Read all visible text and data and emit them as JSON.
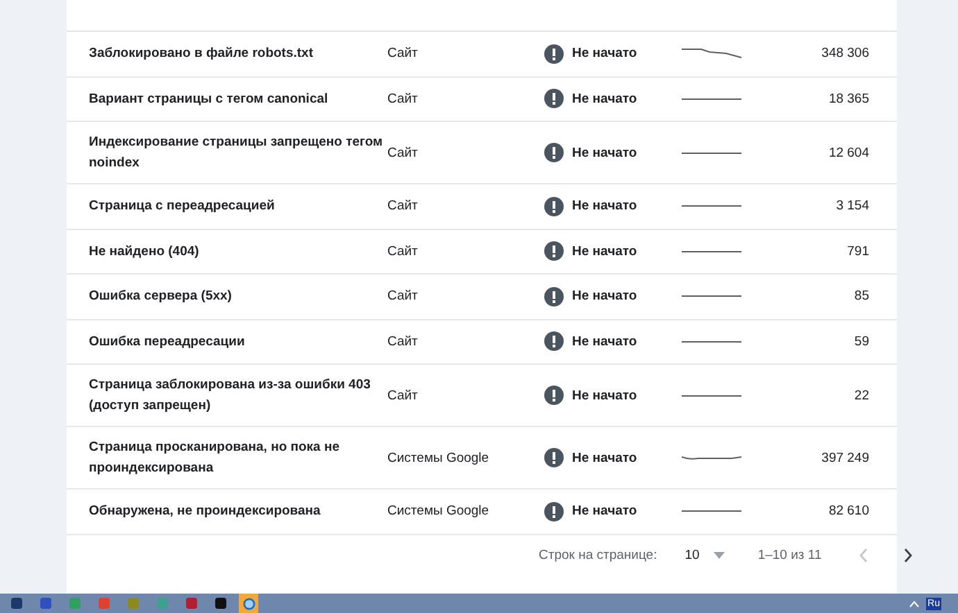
{
  "table": {
    "rows": [
      {
        "reason": "Заблокировано в файле robots.txt",
        "source": "Сайт",
        "status": "Не начато",
        "kind": "falling",
        "pages": "348 306"
      },
      {
        "reason": "Вариант страницы с тегом canonical",
        "source": "Сайт",
        "status": "Не начато",
        "kind": "flat",
        "pages": "18 365"
      },
      {
        "reason": "Индексирование страницы запрещено тегом noindex",
        "source": "Сайт",
        "status": "Не начато",
        "kind": "flat",
        "pages": "12 604"
      },
      {
        "reason": "Страница с переадресацией",
        "source": "Сайт",
        "status": "Не начато",
        "kind": "flat",
        "pages": "3 154"
      },
      {
        "reason": "Не найдено (404)",
        "source": "Сайт",
        "status": "Не начато",
        "kind": "flat",
        "pages": "791"
      },
      {
        "reason": "Ошибка сервера (5xx)",
        "source": "Сайт",
        "status": "Не начато",
        "kind": "flat",
        "pages": "85"
      },
      {
        "reason": "Ошибка переадресации",
        "source": "Сайт",
        "status": "Не начато",
        "kind": "flat",
        "pages": "59"
      },
      {
        "reason": "Страница заблокирована из-за ошибки 403 (доступ запрещен)",
        "source": "Сайт",
        "status": "Не начато",
        "kind": "flat",
        "pages": "22"
      },
      {
        "reason": "Страница просканирована, но пока не проиндексирована",
        "source": "Системы Google",
        "status": "Не начато",
        "kind": "wavy",
        "pages": "397 249"
      },
      {
        "reason": "Обнаружена, не проиндексирована",
        "source": "Системы Google",
        "status": "Не начато",
        "kind": "flat",
        "pages": "82 610"
      }
    ]
  },
  "pagination": {
    "rows_label": "Строк на странице:",
    "rows_value": "10",
    "range": "1–10 из 11",
    "prev_disabled": true,
    "next_disabled": false
  },
  "taskbar": {
    "language": "Ru"
  }
}
